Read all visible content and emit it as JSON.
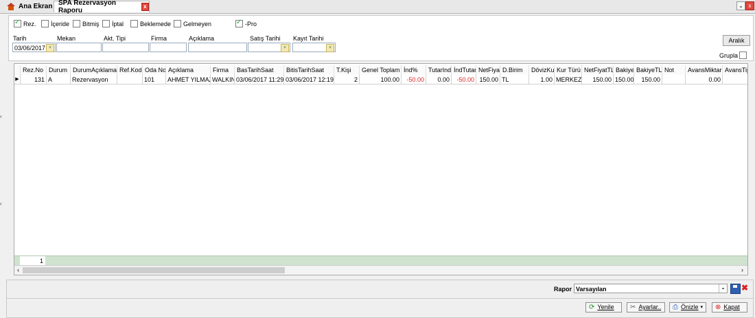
{
  "tabs": [
    {
      "label": "Ana Ekran"
    },
    {
      "label": "SPA Rezervasyon Raporu"
    }
  ],
  "checkboxes": [
    {
      "label": "Rez.",
      "checked": true
    },
    {
      "label": "İçeride",
      "checked": false
    },
    {
      "label": "Bitmiş",
      "checked": false
    },
    {
      "label": "İptal",
      "checked": false
    },
    {
      "label": "Beklemede",
      "checked": false
    },
    {
      "label": "Gelmeyen",
      "checked": false
    },
    {
      "label": "-Pro",
      "checked": true
    }
  ],
  "filters": {
    "tarih_label": "Tarih",
    "tarih_value": "03/06/2017",
    "mekan_label": "Mekan",
    "akt_label": "Akt. Tipi",
    "firma_label": "Firma",
    "aciklama_label": "Açıklama",
    "satis_label": "Satış Tarihi",
    "kayit_label": "Kayıt Tarihi",
    "aralik_label": "Aralık",
    "grupla_label": "Grupla"
  },
  "grid": {
    "headers": [
      "Rez.No",
      "Durum",
      "DurumAçıklama",
      "Ref.Kod",
      "Oda No",
      "Açıklama",
      "Firma",
      "BasTarihSaat",
      "BitisTarihSaat",
      "T.Kişi",
      "Genel Toplam",
      "İnd%",
      "TutarInd",
      "İndTutar",
      "NetFiyat",
      "D.Birim",
      "DövizKu",
      "Kur Türü",
      "NetFiyatTL",
      "Bakiye",
      "BakiyeTL",
      "Not",
      "AvansMiktar",
      "AvansTipi"
    ],
    "row": [
      "131",
      "A",
      "Rezervasyon",
      "",
      "101",
      "AHMET YILMAZ",
      "WALKIN",
      "03/06/2017 11:29",
      "03/06/2017 12:19",
      "2",
      "100.00",
      "-50.00",
      "0.00",
      "-50.00",
      "150.00",
      "TL",
      "1.00",
      "MERKEZ",
      "150.00",
      "150.00",
      "150.00",
      "",
      "0.00",
      ""
    ],
    "count": "1"
  },
  "rapor": {
    "label": "Rapor",
    "value": "Varsayılan"
  },
  "actions": {
    "yenile": "Yenile",
    "ayarlar": "Ayarlar..",
    "onizle": "Önizle",
    "kapat": "Kapat"
  }
}
